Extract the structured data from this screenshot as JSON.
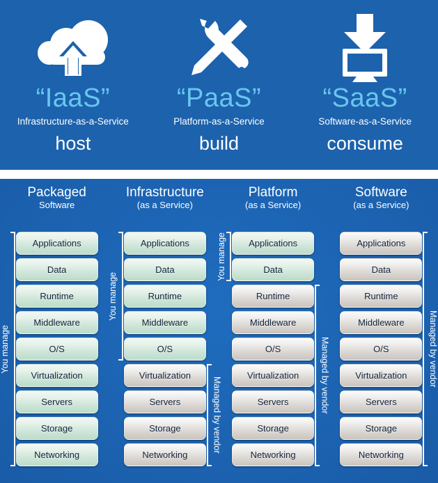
{
  "banner": {
    "services": [
      {
        "icon": "cloud-upload-icon",
        "abbr": "“IaaS”",
        "full": "Infrastructure-as-a-Service",
        "verb": "host"
      },
      {
        "icon": "wrench-screwdriver-icon",
        "abbr": "“PaaS”",
        "full": "Platform-as-a-Service",
        "verb": "build"
      },
      {
        "icon": "download-to-monitor-icon",
        "abbr": "“SaaS”",
        "full": "Software-as-a-Service",
        "verb": "consume"
      }
    ]
  },
  "stack": {
    "layer_names": [
      "Applications",
      "Data",
      "Runtime",
      "Middleware",
      "O/S",
      "Virtualization",
      "Servers",
      "Storage",
      "Networking"
    ],
    "labels": {
      "you_manage": "You manage",
      "managed_by_vendor": "Managed by vendor"
    },
    "columns": [
      {
        "title_main": "Packaged",
        "title_sub": "Software",
        "layers": [
          {
            "name": "Applications",
            "owner": "you"
          },
          {
            "name": "Data",
            "owner": "you"
          },
          {
            "name": "Runtime",
            "owner": "you"
          },
          {
            "name": "Middleware",
            "owner": "you"
          },
          {
            "name": "O/S",
            "owner": "you"
          },
          {
            "name": "Virtualization",
            "owner": "you"
          },
          {
            "name": "Servers",
            "owner": "you"
          },
          {
            "name": "Storage",
            "owner": "you"
          },
          {
            "name": "Networking",
            "owner": "you"
          }
        ],
        "brackets": [
          {
            "label": "You manage",
            "side": "left",
            "from": 0,
            "to": 8
          }
        ]
      },
      {
        "title_main": "Infrastructure",
        "title_sub": "(as a Service)",
        "layers": [
          {
            "name": "Applications",
            "owner": "you"
          },
          {
            "name": "Data",
            "owner": "you"
          },
          {
            "name": "Runtime",
            "owner": "you"
          },
          {
            "name": "Middleware",
            "owner": "you"
          },
          {
            "name": "O/S",
            "owner": "you"
          },
          {
            "name": "Virtualization",
            "owner": "vendor"
          },
          {
            "name": "Servers",
            "owner": "vendor"
          },
          {
            "name": "Storage",
            "owner": "vendor"
          },
          {
            "name": "Networking",
            "owner": "vendor"
          }
        ],
        "brackets": [
          {
            "label": "You manage",
            "side": "left",
            "from": 0,
            "to": 4
          },
          {
            "label": "Managed by vendor",
            "side": "right",
            "from": 5,
            "to": 8
          }
        ]
      },
      {
        "title_main": "Platform",
        "title_sub": "(as a Service)",
        "layers": [
          {
            "name": "Applications",
            "owner": "you"
          },
          {
            "name": "Data",
            "owner": "you"
          },
          {
            "name": "Runtime",
            "owner": "vendor"
          },
          {
            "name": "Middleware",
            "owner": "vendor"
          },
          {
            "name": "O/S",
            "owner": "vendor"
          },
          {
            "name": "Virtualization",
            "owner": "vendor"
          },
          {
            "name": "Servers",
            "owner": "vendor"
          },
          {
            "name": "Storage",
            "owner": "vendor"
          },
          {
            "name": "Networking",
            "owner": "vendor"
          }
        ],
        "brackets": [
          {
            "label": "You manage",
            "side": "left",
            "from": 0,
            "to": 1
          },
          {
            "label": "Managed by vendor",
            "side": "right",
            "from": 2,
            "to": 8
          }
        ]
      },
      {
        "title_main": "Software",
        "title_sub": "(as a Service)",
        "layers": [
          {
            "name": "Applications",
            "owner": "vendor"
          },
          {
            "name": "Data",
            "owner": "vendor"
          },
          {
            "name": "Runtime",
            "owner": "vendor"
          },
          {
            "name": "Middleware",
            "owner": "vendor"
          },
          {
            "name": "O/S",
            "owner": "vendor"
          },
          {
            "name": "Virtualization",
            "owner": "vendor"
          },
          {
            "name": "Servers",
            "owner": "vendor"
          },
          {
            "name": "Storage",
            "owner": "vendor"
          },
          {
            "name": "Networking",
            "owner": "vendor"
          }
        ],
        "brackets": [
          {
            "label": "Managed by vendor",
            "side": "right",
            "from": 0,
            "to": 8
          }
        ]
      }
    ]
  },
  "colors": {
    "banner_blue": "#1c62ad",
    "panel_blue": "#1b60ad",
    "accent_cyan": "#68c6ef",
    "you_manage_box": "#cfe6da",
    "vendor_box": "#dcd8d4",
    "text_white": "#ffffff"
  }
}
